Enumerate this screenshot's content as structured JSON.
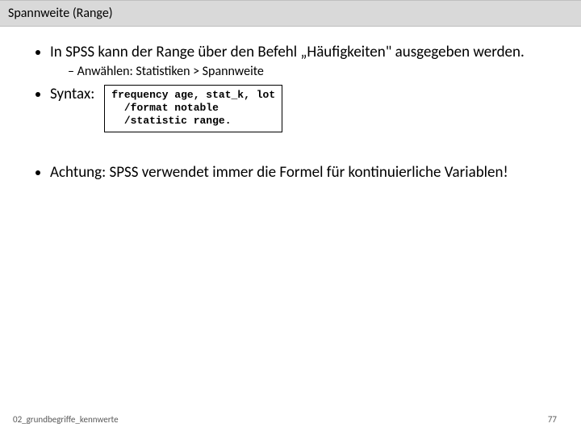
{
  "title": "Spannweite (Range)",
  "bullets": {
    "b1": "In SPSS kann der Range über den Befehl „Häufigkeiten\" ausgegeben werden.",
    "b1_sub": "Anwählen: Statistiken > Spannweite",
    "syntax_label": "Syntax:",
    "code": "frequency age, stat_k, lot\n  /format notable\n  /statistic range.",
    "b3": "Achtung: SPSS verwendet immer die Formel für kontinuierliche Variablen!"
  },
  "footer": {
    "left": "02_grundbegriffe_kennwerte",
    "page": "77"
  }
}
